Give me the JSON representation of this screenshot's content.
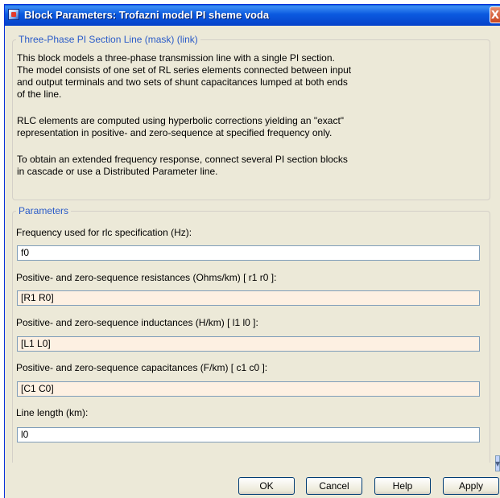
{
  "window": {
    "title": "Block Parameters: Trofazni model PI sheme voda",
    "close_glyph": "X"
  },
  "mask": {
    "legend": "Three-Phase PI Section Line (mask) (link)",
    "description": [
      "This block models a three-phase transmission line with a single PI section.",
      "The model consists of one set of RL series elements connected between input",
      "and output terminals and two sets of shunt capacitances lumped at both ends",
      "of the line.",
      "",
      "RLC elements are computed using hyperbolic corrections yielding an \"exact\"",
      "representation in positive- and zero-sequence at specified frequency only.",
      "",
      "To obtain an extended frequency response, connect several PI section blocks",
      "in cascade or use a Distributed Parameter line."
    ]
  },
  "parameters": {
    "legend": "Parameters",
    "items": [
      {
        "label": "Frequency used for rlc specification (Hz):",
        "value": "f0"
      },
      {
        "label": "Positive- and zero-sequence resistances (Ohms/km) [ r1  r0 ]:",
        "value": "[R1 R0]"
      },
      {
        "label": "Positive- and zero-sequence inductances (H/km) [ l1  l0 ]:",
        "value": "[L1 L0]"
      },
      {
        "label": "Positive- and zero-sequence capacitances (F/km) [ c1 c0 ]:",
        "value": "[C1 C0]"
      },
      {
        "label": "Line length (km):",
        "value": "l0"
      }
    ]
  },
  "buttons": {
    "ok": "OK",
    "cancel": "Cancel",
    "help": "Help",
    "apply": "Apply"
  },
  "colors": {
    "titlebar": "#0b5ae0",
    "dialog_bg": "#ece9d8",
    "legend_text": "#2a5bc8",
    "field_tan": "#fdf0e2"
  }
}
